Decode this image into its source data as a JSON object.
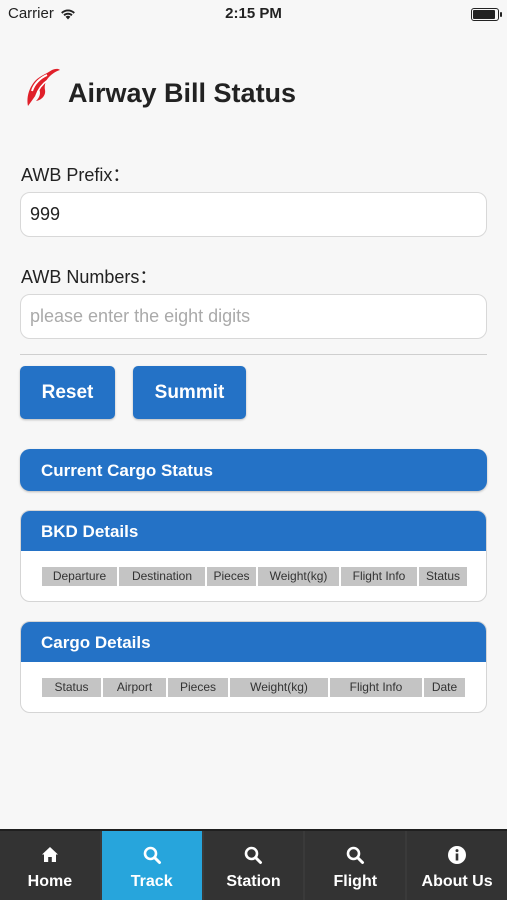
{
  "status_bar": {
    "carrier": "Carrier",
    "time": "2:15 PM",
    "battery_level": 0.95
  },
  "header": {
    "title": "Airway Bill Status",
    "logo_color": "#e0202a"
  },
  "form": {
    "prefix_label": "AWB Prefix：",
    "prefix_value": "999",
    "numbers_label": "AWB Numbers：",
    "numbers_value": "",
    "numbers_placeholder": "please enter the eight digits",
    "reset_label": "Reset",
    "submit_label": "Summit"
  },
  "current_status": {
    "label": "Current Cargo Status"
  },
  "bkd_details": {
    "title": "BKD Details",
    "columns": [
      "Departure",
      "Destination",
      "Pieces",
      "Weight(kg)",
      "Flight Info",
      "Status"
    ]
  },
  "cargo_details": {
    "title": "Cargo Details",
    "columns": [
      "Status",
      "Airport",
      "Pieces",
      "Weight(kg)",
      "Flight Info",
      "Date"
    ]
  },
  "tabs": [
    {
      "label": "Home",
      "icon": "home-icon",
      "active": false
    },
    {
      "label": "Track",
      "icon": "search-icon",
      "active": true
    },
    {
      "label": "Station",
      "icon": "search-icon",
      "active": false
    },
    {
      "label": "Flight",
      "icon": "search-icon",
      "active": false
    },
    {
      "label": "About Us",
      "icon": "info-icon",
      "active": false
    }
  ],
  "colors": {
    "primary": "#2472c6",
    "active_tab": "#27a5dc",
    "tab_bar": "#333333"
  }
}
